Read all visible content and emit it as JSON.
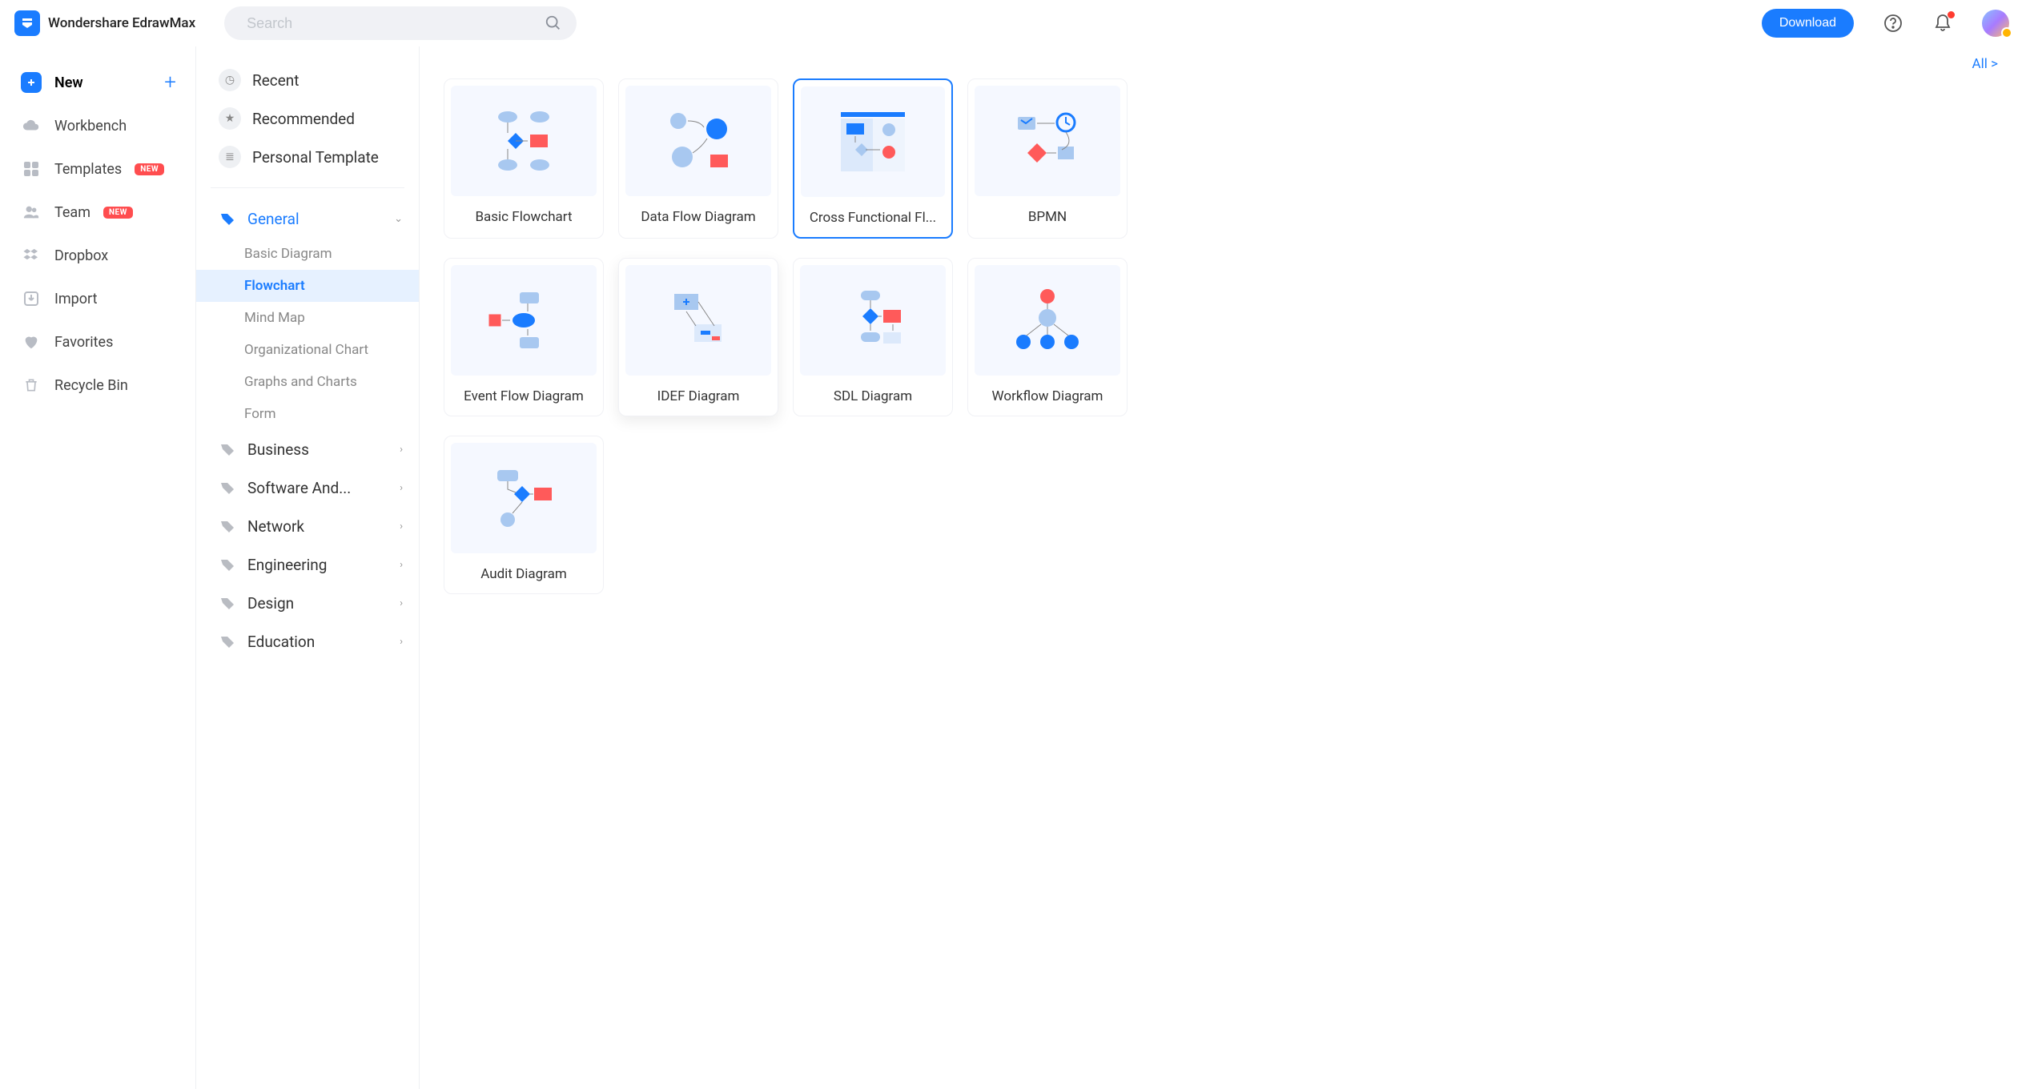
{
  "app_title": "Wondershare EdrawMax",
  "search_placeholder": "Search",
  "download_label": "Download",
  "sidebar": [
    {
      "key": "new",
      "label": "New",
      "icon": "plus-box",
      "active": true,
      "has_plus": true
    },
    {
      "key": "workbench",
      "label": "Workbench",
      "icon": "cloud"
    },
    {
      "key": "templates",
      "label": "Templates",
      "icon": "grid",
      "badge": "NEW"
    },
    {
      "key": "team",
      "label": "Team",
      "icon": "people",
      "badge": "NEW"
    },
    {
      "key": "dropbox",
      "label": "Dropbox",
      "icon": "dropbox"
    },
    {
      "key": "import",
      "label": "Import",
      "icon": "import"
    },
    {
      "key": "favorites",
      "label": "Favorites",
      "icon": "heart"
    },
    {
      "key": "recycle",
      "label": "Recycle Bin",
      "icon": "trash"
    }
  ],
  "cat_top": [
    {
      "key": "recent",
      "label": "Recent",
      "icon": "clock"
    },
    {
      "key": "recommended",
      "label": "Recommended",
      "icon": "star"
    },
    {
      "key": "personal",
      "label": "Personal Template",
      "icon": "doc"
    }
  ],
  "cat_sections": [
    {
      "key": "general",
      "label": "General",
      "expanded": true,
      "icon_color": "#1a7cff",
      "subs": [
        {
          "key": "basic",
          "label": "Basic Diagram"
        },
        {
          "key": "flowchart",
          "label": "Flowchart",
          "selected": true
        },
        {
          "key": "mindmap",
          "label": "Mind Map"
        },
        {
          "key": "org",
          "label": "Organizational Chart"
        },
        {
          "key": "graphs",
          "label": "Graphs and Charts"
        },
        {
          "key": "form",
          "label": "Form"
        }
      ]
    },
    {
      "key": "business",
      "label": "Business"
    },
    {
      "key": "software",
      "label": "Software And..."
    },
    {
      "key": "network",
      "label": "Network"
    },
    {
      "key": "engineering",
      "label": "Engineering"
    },
    {
      "key": "design",
      "label": "Design"
    },
    {
      "key": "education",
      "label": "Education"
    }
  ],
  "all_link": "All  >",
  "cards": [
    {
      "key": "basic-flowchart",
      "label": "Basic Flowchart"
    },
    {
      "key": "data-flow",
      "label": "Data Flow Diagram"
    },
    {
      "key": "cross-func",
      "label": "Cross Functional Fl...",
      "selected": true
    },
    {
      "key": "bpmn",
      "label": "BPMN"
    },
    {
      "key": "event-flow",
      "label": "Event Flow Diagram"
    },
    {
      "key": "idef",
      "label": "IDEF Diagram",
      "hover": true
    },
    {
      "key": "sdl",
      "label": "SDL Diagram"
    },
    {
      "key": "workflow",
      "label": "Workflow Diagram"
    },
    {
      "key": "audit",
      "label": "Audit Diagram"
    }
  ]
}
